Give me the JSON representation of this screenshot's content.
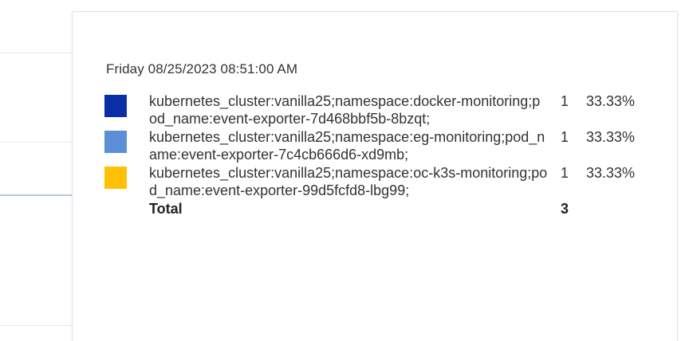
{
  "tooltip": {
    "timestamp": "Friday 08/25/2023 08:51:00 AM",
    "rows": [
      {
        "color": "#0a2ea8",
        "label": "kubernetes_cluster:vanilla25;namespace:docker-monitoring;pod_name:event-exporter-7d468bbf5b-8bzqt;",
        "count": "1",
        "percent": "33.33%"
      },
      {
        "color": "#5b8fd6",
        "label": "kubernetes_cluster:vanilla25;namespace:eg-monitoring;pod_name:event-exporter-7c4cb666d6-xd9mb;",
        "count": "1",
        "percent": "33.33%"
      },
      {
        "color": "#ffc107",
        "label": "kubernetes_cluster:vanilla25;namespace:oc-k3s-monitoring;pod_name:event-exporter-99d5fcfd8-lbg99;",
        "count": "1",
        "percent": "33.33%"
      }
    ],
    "total": {
      "label": "Total",
      "count": "3"
    }
  }
}
